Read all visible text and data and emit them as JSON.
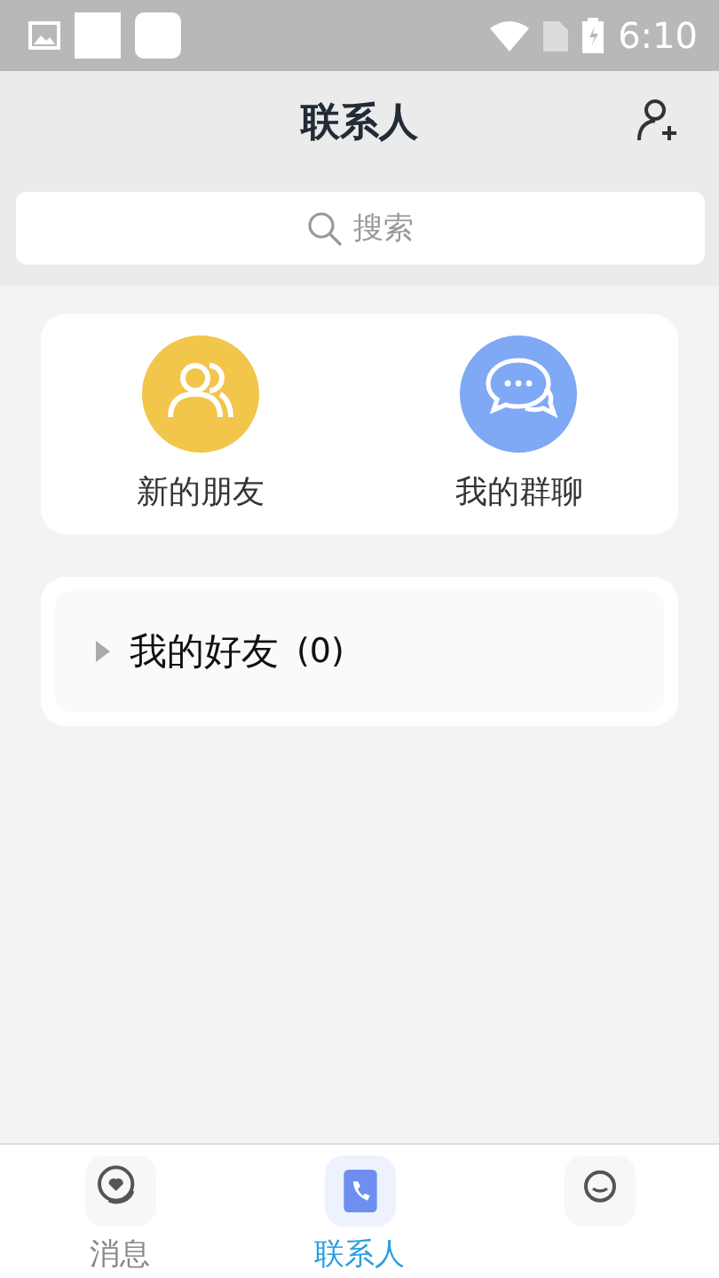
{
  "status_bar": {
    "time": "6:10"
  },
  "header": {
    "title": "联系人"
  },
  "search": {
    "placeholder": "搜索"
  },
  "shortcuts": [
    {
      "label": "新的朋友",
      "kind": "friends",
      "color": "#f2c54b"
    },
    {
      "label": "我的群聊",
      "kind": "groups",
      "color": "#7fa8f5"
    }
  ],
  "groups": [
    {
      "label": "我的好友",
      "count": "(0)",
      "expanded": false
    }
  ],
  "tabs": [
    {
      "label": "消息",
      "kind": "messages",
      "selected": false
    },
    {
      "label": "联系人",
      "kind": "contacts",
      "selected": true
    },
    {
      "kind": "profile",
      "selected": false
    }
  ]
}
